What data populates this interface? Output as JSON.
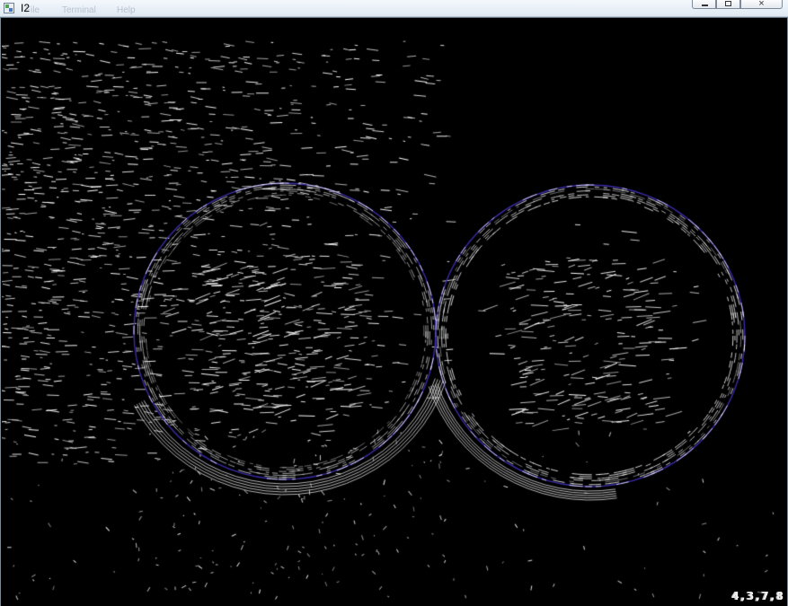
{
  "window": {
    "title": "I2",
    "faded_menu": [
      "File",
      "Terminal",
      "Help"
    ],
    "controls": {
      "minimize": "",
      "maximize": "",
      "close": "×"
    }
  },
  "image": {
    "description_label": "",
    "corner_text": "4,3,7,8",
    "colors": {
      "background": "#000000",
      "edge_white": "#f5f5f5",
      "circle_blue": "#3a2ca8"
    }
  }
}
